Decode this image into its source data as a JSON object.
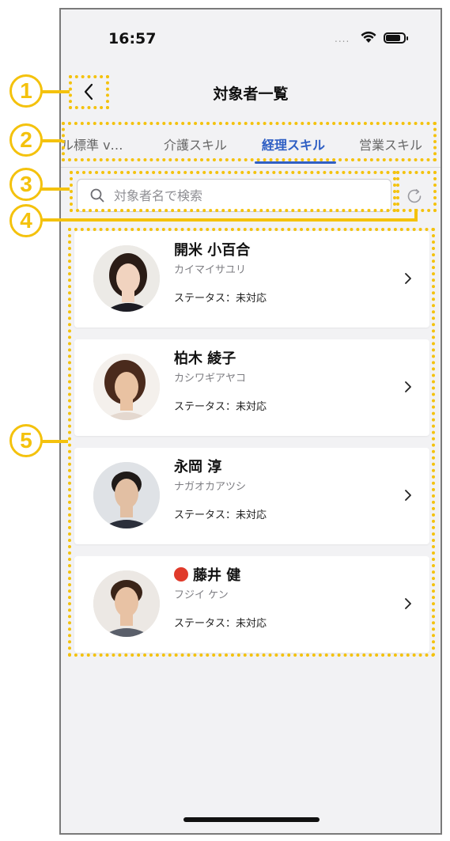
{
  "status_bar": {
    "time": "16:57",
    "signal": "....",
    "battery_level": 0.8
  },
  "nav": {
    "title": "対象者一覧"
  },
  "tabs": [
    {
      "label": "ル標準 v…",
      "active": false
    },
    {
      "label": "介護スキル",
      "active": false
    },
    {
      "label": "経理スキル",
      "active": true
    },
    {
      "label": "営業スキル",
      "active": false
    }
  ],
  "search": {
    "placeholder": "対象者名で検索"
  },
  "people": [
    {
      "name": "開米 小百合",
      "kana": "カイマイサユリ",
      "status": "ステータス：未対応",
      "alert": false
    },
    {
      "name": "柏木 綾子",
      "kana": "カシワギアヤコ",
      "status": "ステータス：未対応",
      "alert": false
    },
    {
      "name": "永岡 淳",
      "kana": "ナガオカアツシ",
      "status": "ステータス：未対応",
      "alert": false
    },
    {
      "name": "藤井 健",
      "kana": "フジイ ケン",
      "status": "ステータス：未対応",
      "alert": true
    }
  ],
  "annotations": [
    "1",
    "2",
    "3",
    "4",
    "5"
  ],
  "colors": {
    "accent": "#2f5fc4",
    "annotation": "#f4c20d",
    "alert": "#e03a2a"
  }
}
